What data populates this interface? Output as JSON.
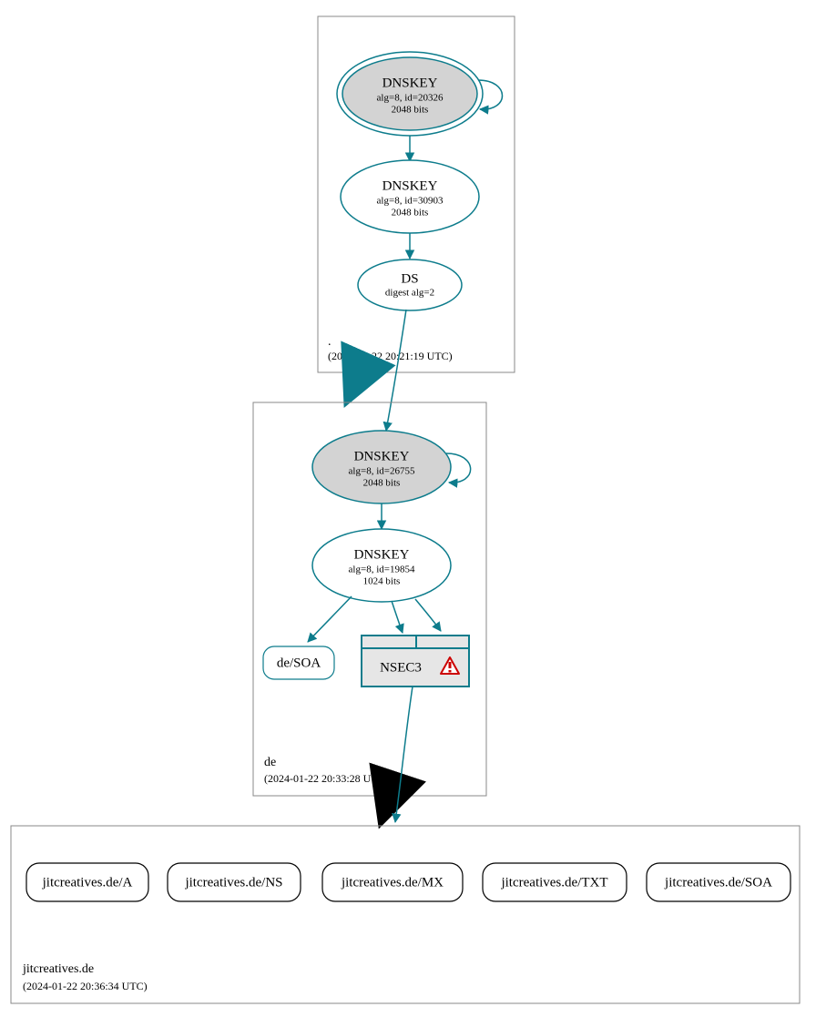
{
  "colors": {
    "accent": "#0d7c8c",
    "warn": "#c00",
    "grey_fill": "#d3d3d3",
    "nsec_fill": "#e6e6e6"
  },
  "zones": {
    "root": {
      "name": ".",
      "timestamp": "(2024-01-22 20:21:19 UTC)"
    },
    "de": {
      "name": "de",
      "timestamp": "(2024-01-22 20:33:28 UTC)"
    },
    "jitcreatives": {
      "name": "jitcreatives.de",
      "timestamp": "(2024-01-22 20:36:34 UTC)"
    }
  },
  "nodes": {
    "root_ksk": {
      "title": "DNSKEY",
      "sub1": "alg=8, id=20326",
      "sub2": "2048 bits"
    },
    "root_zsk": {
      "title": "DNSKEY",
      "sub1": "alg=8, id=30903",
      "sub2": "2048 bits"
    },
    "root_ds": {
      "title": "DS",
      "sub1": "digest alg=2"
    },
    "de_ksk": {
      "title": "DNSKEY",
      "sub1": "alg=8, id=26755",
      "sub2": "2048 bits"
    },
    "de_zsk": {
      "title": "DNSKEY",
      "sub1": "alg=8, id=19854",
      "sub2": "1024 bits"
    },
    "de_soa": {
      "label": "de/SOA"
    },
    "de_nsec3": {
      "label": "NSEC3"
    }
  },
  "records": {
    "a": {
      "label": "jitcreatives.de/A"
    },
    "ns": {
      "label": "jitcreatives.de/NS"
    },
    "mx": {
      "label": "jitcreatives.de/MX"
    },
    "txt": {
      "label": "jitcreatives.de/TXT"
    },
    "soa": {
      "label": "jitcreatives.de/SOA"
    }
  }
}
